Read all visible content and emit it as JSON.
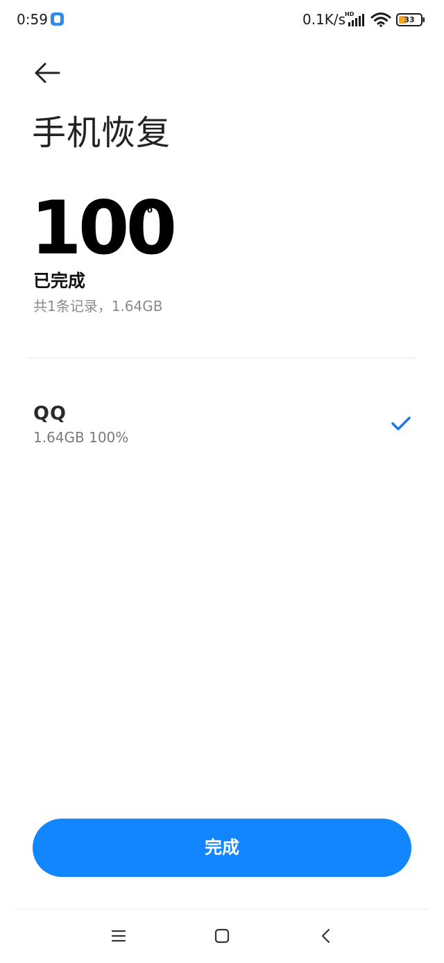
{
  "status_bar": {
    "time": "0:59",
    "net_speed": "0.1K/s",
    "hd_label": "HD",
    "battery_level": "33",
    "notification_icon": "app-notification-icon",
    "signal_icon": "cellular-signal-icon",
    "wifi_icon": "wifi-icon",
    "battery_icon": "battery-icon"
  },
  "header": {
    "back_icon": "arrow-left-icon",
    "title": "手机恢复"
  },
  "progress": {
    "value": "100",
    "unit": "%",
    "status": "已完成",
    "summary": "共1条记录，1.64GB"
  },
  "records": [
    {
      "name": "QQ",
      "detail": "1.64GB 100%",
      "status_icon": "checkmark-icon"
    }
  ],
  "actions": {
    "done_label": "完成"
  },
  "nav_bar": {
    "menu_icon": "menu-icon",
    "home_icon": "home-square-icon",
    "back_icon": "chevron-left-icon"
  },
  "colors": {
    "accent": "#1286ff",
    "check": "#1878e8",
    "battery_fill": "#f5a623"
  }
}
